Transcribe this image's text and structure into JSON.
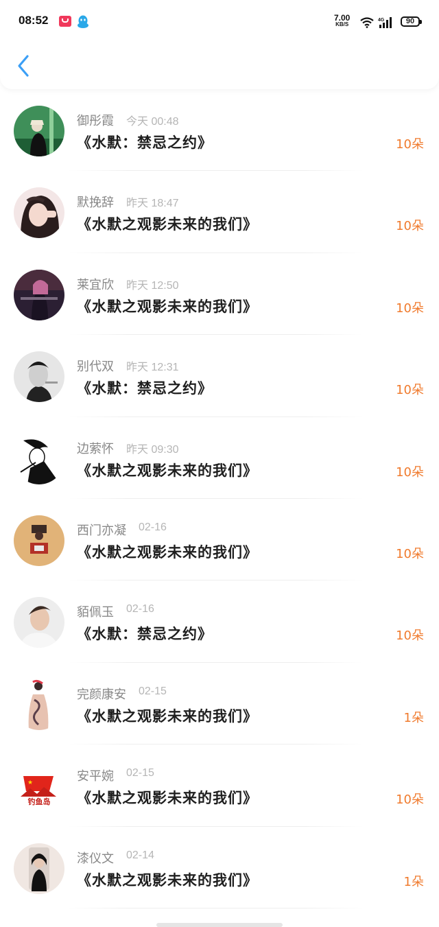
{
  "status": {
    "time": "08:52",
    "speed_value": "7.00",
    "speed_unit": "KB/S",
    "network": "4G",
    "battery": "90"
  },
  "colors": {
    "accent_blue": "#3b9ff6",
    "amount_orange": "#f07b2e"
  },
  "icons": {
    "back": "chevron-left-icon",
    "qq": "qq-penguin-icon"
  },
  "records": [
    {
      "name": "御彤霞",
      "time": "今天 00:48",
      "title": "《水默：禁忌之约》",
      "amount": "10朵"
    },
    {
      "name": "默挽辞",
      "time": "昨天 18:47",
      "title": "《水默之观影未来的我们》",
      "amount": "10朵"
    },
    {
      "name": "莱宜欣",
      "time": "昨天 12:50",
      "title": "《水默之观影未来的我们》",
      "amount": "10朵"
    },
    {
      "name": "别代双",
      "time": "昨天 12:31",
      "title": "《水默：禁忌之约》",
      "amount": "10朵"
    },
    {
      "name": "边萦怀",
      "time": "昨天 09:30",
      "title": "《水默之观影未来的我们》",
      "amount": "10朵"
    },
    {
      "name": "西门亦凝",
      "time": "02-16",
      "title": "《水默之观影未来的我们》",
      "amount": "10朵"
    },
    {
      "name": "貊佩玉",
      "time": "02-16",
      "title": "《水默：禁忌之约》",
      "amount": "10朵"
    },
    {
      "name": "完颜康安",
      "time": "02-15",
      "title": "《水默之观影未来的我们》",
      "amount": "1朵"
    },
    {
      "name": "安平婉",
      "time": "02-15",
      "title": "《水默之观影未来的我们》",
      "amount": "10朵"
    },
    {
      "name": "漆仪文",
      "time": "02-14",
      "title": "《水默之观影未来的我们》",
      "amount": "1朵"
    }
  ]
}
